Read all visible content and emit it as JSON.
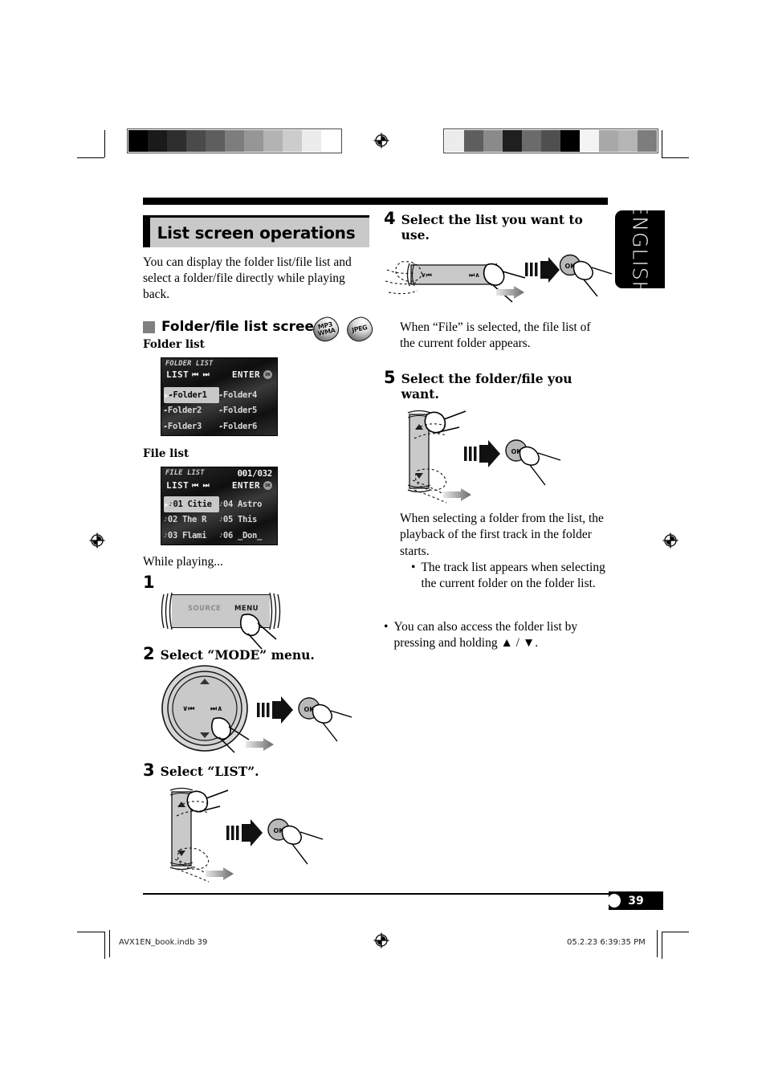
{
  "section": {
    "title": "List screen operations",
    "intro": "You can display the folder list/file list and select a folder/file directly while playing back.",
    "subheading": "Folder/file list screens",
    "folder_list_label": "Folder list",
    "file_list_label": "File list",
    "while_playing": "While playing..."
  },
  "badges": [
    {
      "name": "mp3-wma-badge",
      "line1": "MP3",
      "line2": "WMA"
    },
    {
      "name": "jpeg-badge",
      "line1": "JPEG",
      "line2": ""
    }
  ],
  "folder_screen": {
    "tag": "FOLDER LIST",
    "count": "",
    "list_label": "LIST",
    "nav_icons": "⏮ ⏭",
    "enter_label": "ENTER",
    "ok_icon": "OK",
    "cursor": "▶",
    "items": [
      {
        "prefix": "▰",
        "text": "Folder1",
        "selected": true
      },
      {
        "prefix": "▰",
        "text": "Folder4",
        "selected": false
      },
      {
        "prefix": "▰",
        "text": "Folder2",
        "selected": false
      },
      {
        "prefix": "▰",
        "text": "Folder5",
        "selected": false
      },
      {
        "prefix": "▰",
        "text": "Folder3",
        "selected": false
      },
      {
        "prefix": "▰",
        "text": "Folder6",
        "selected": false
      }
    ]
  },
  "file_screen": {
    "tag": "FILE LIST",
    "count": "001/032",
    "list_label": "LIST",
    "nav_icons": "⏮ ⏭",
    "enter_label": "ENTER",
    "ok_icon": "OK",
    "cursor": "▶",
    "items": [
      {
        "prefix": "♪",
        "text": "01 Citie",
        "selected": true
      },
      {
        "prefix": "♪",
        "text": "04 Astro",
        "selected": false
      },
      {
        "prefix": "♪",
        "text": "02 The R",
        "selected": false
      },
      {
        "prefix": "♪",
        "text": "05 This",
        "selected": false
      },
      {
        "prefix": "♪",
        "text": "03 Flami",
        "selected": false
      },
      {
        "prefix": "♪",
        "text": "06 _Don_",
        "selected": false
      }
    ]
  },
  "steps": [
    {
      "num": "1",
      "caption": ""
    },
    {
      "num": "2",
      "caption": "Select “MODE” menu."
    },
    {
      "num": "3",
      "caption": "Select “LIST”."
    },
    {
      "num": "4",
      "caption": "Select the list you want to use."
    },
    {
      "num": "5",
      "caption": "Select the folder/file you want."
    }
  ],
  "faceplate": {
    "source_label": "SOURCE",
    "menu_label": "MENU"
  },
  "controls": {
    "ok_label": "OK",
    "left_cluster": "∨⏮",
    "right_cluster": "⏭∧",
    "up_arrow": "▲",
    "down_arrow": "▼"
  },
  "notes": {
    "after_step4": "When “File” is selected, the file list of the current folder appears.",
    "after_step5": "When selecting a folder from the list, the playback of the first track in the folder starts.",
    "after_step5_bullet": "The track list appears when selecting the current folder on the folder list.",
    "bullet_dot": "•",
    "final_bullet": "You can also access the folder list by pressing and holding ▲ / ▼."
  },
  "side_tab": {
    "label": "ENGLISH"
  },
  "page_number": "39",
  "footer": {
    "file": "AVX1EN_book.indb   39",
    "timestamp": "05.2.23   6:39:35 PM"
  },
  "calibration": {
    "left_swatches": [
      "#000000",
      "#1a1a1a",
      "#2e2e2e",
      "#4a4a4a",
      "#5e5e5e",
      "#7d7d7d",
      "#969696",
      "#b3b3b3",
      "#cccccc",
      "#ececec",
      "#ffffff"
    ],
    "right_swatches": [
      "#ececec",
      "#5e5e5e",
      "#8a8a8a",
      "#1f1f1f",
      "#6b6b6b",
      "#4f4f4f",
      "#000000",
      "#f4f4f4",
      "#a8a8a8",
      "#b5b5b5",
      "#7d7d7d"
    ]
  }
}
